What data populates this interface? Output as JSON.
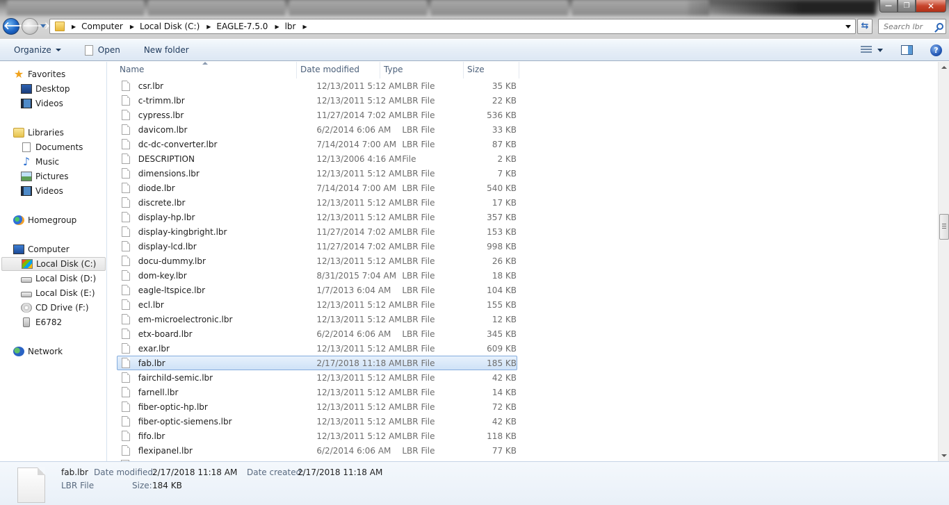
{
  "window": {
    "controls": {
      "minimize": "—",
      "maximize": "❐",
      "close": "✕"
    }
  },
  "nav": {
    "back_icon": "🡐",
    "forward_icon": "🡒",
    "breadcrumb": [
      "Computer",
      "Local Disk (C:)",
      "EAGLE-7.5.0",
      "lbr"
    ],
    "crumb_separator": "▶",
    "refresh_icon": "⇆",
    "search_placeholder": "Search lbr"
  },
  "toolbar": {
    "organize_label": "Organize",
    "open_label": "Open",
    "new_folder_label": "New folder",
    "help_label": "?"
  },
  "sidebar": {
    "favorites": {
      "label": "Favorites",
      "items": [
        "Desktop",
        "Videos"
      ]
    },
    "libraries": {
      "label": "Libraries",
      "items": [
        "Documents",
        "Music",
        "Pictures",
        "Videos"
      ]
    },
    "homegroup": {
      "label": "Homegroup"
    },
    "computer": {
      "label": "Computer",
      "items": [
        "Local Disk (C:)",
        "Local Disk (D:)",
        "Local Disk (E:)",
        "CD Drive (F:)",
        "E6782"
      ],
      "selected": "Local Disk (C:)"
    },
    "network": {
      "label": "Network"
    }
  },
  "columns": {
    "name": "Name",
    "date": "Date modified",
    "type": "Type",
    "size": "Size"
  },
  "files": [
    {
      "name": "csr.lbr",
      "date": "12/13/2011 5:12 AM",
      "type": "LBR File",
      "size": "35 KB"
    },
    {
      "name": "c-trimm.lbr",
      "date": "12/13/2011 5:12 AM",
      "type": "LBR File",
      "size": "22 KB"
    },
    {
      "name": "cypress.lbr",
      "date": "11/27/2014 7:02 AM",
      "type": "LBR File",
      "size": "536 KB"
    },
    {
      "name": "davicom.lbr",
      "date": "6/2/2014 6:06 AM",
      "type": "LBR File",
      "size": "33 KB"
    },
    {
      "name": "dc-dc-converter.lbr",
      "date": "7/14/2014 7:00 AM",
      "type": "LBR File",
      "size": "87 KB"
    },
    {
      "name": "DESCRIPTION",
      "date": "12/13/2006 4:16 AM",
      "type": "File",
      "size": "2 KB"
    },
    {
      "name": "dimensions.lbr",
      "date": "12/13/2011 5:12 AM",
      "type": "LBR File",
      "size": "7 KB"
    },
    {
      "name": "diode.lbr",
      "date": "7/14/2014 7:00 AM",
      "type": "LBR File",
      "size": "540 KB"
    },
    {
      "name": "discrete.lbr",
      "date": "12/13/2011 5:12 AM",
      "type": "LBR File",
      "size": "17 KB"
    },
    {
      "name": "display-hp.lbr",
      "date": "12/13/2011 5:12 AM",
      "type": "LBR File",
      "size": "357 KB"
    },
    {
      "name": "display-kingbright.lbr",
      "date": "11/27/2014 7:02 AM",
      "type": "LBR File",
      "size": "153 KB"
    },
    {
      "name": "display-lcd.lbr",
      "date": "11/27/2014 7:02 AM",
      "type": "LBR File",
      "size": "998 KB"
    },
    {
      "name": "docu-dummy.lbr",
      "date": "12/13/2011 5:12 AM",
      "type": "LBR File",
      "size": "26 KB"
    },
    {
      "name": "dom-key.lbr",
      "date": "8/31/2015 7:04 AM",
      "type": "LBR File",
      "size": "18 KB"
    },
    {
      "name": "eagle-ltspice.lbr",
      "date": "1/7/2013 6:04 AM",
      "type": "LBR File",
      "size": "104 KB"
    },
    {
      "name": "ecl.lbr",
      "date": "12/13/2011 5:12 AM",
      "type": "LBR File",
      "size": "155 KB"
    },
    {
      "name": "em-microelectronic.lbr",
      "date": "12/13/2011 5:12 AM",
      "type": "LBR File",
      "size": "12 KB"
    },
    {
      "name": "etx-board.lbr",
      "date": "6/2/2014 6:06 AM",
      "type": "LBR File",
      "size": "345 KB"
    },
    {
      "name": "exar.lbr",
      "date": "12/13/2011 5:12 AM",
      "type": "LBR File",
      "size": "609 KB"
    },
    {
      "name": "fab.lbr",
      "date": "2/17/2018 11:18 AM",
      "type": "LBR File",
      "size": "185 KB",
      "selected": true
    },
    {
      "name": "fairchild-semic.lbr",
      "date": "12/13/2011 5:12 AM",
      "type": "LBR File",
      "size": "42 KB"
    },
    {
      "name": "farnell.lbr",
      "date": "12/13/2011 5:12 AM",
      "type": "LBR File",
      "size": "14 KB"
    },
    {
      "name": "fiber-optic-hp.lbr",
      "date": "12/13/2011 5:12 AM",
      "type": "LBR File",
      "size": "72 KB"
    },
    {
      "name": "fiber-optic-siemens.lbr",
      "date": "12/13/2011 5:12 AM",
      "type": "LBR File",
      "size": "42 KB"
    },
    {
      "name": "fifo.lbr",
      "date": "12/13/2011 5:12 AM",
      "type": "LBR File",
      "size": "118 KB"
    },
    {
      "name": "flexipanel.lbr",
      "date": "6/2/2014 6:06 AM",
      "type": "LBR File",
      "size": "77 KB"
    }
  ],
  "details": {
    "name": "fab.lbr",
    "type": "LBR File",
    "date_modified_label": "Date modified:",
    "date_modified": "2/17/2018 11:18 AM",
    "date_created_label": "Date created:",
    "date_created": "2/17/2018 11:18 AM",
    "size_label": "Size:",
    "size": "184 KB"
  }
}
